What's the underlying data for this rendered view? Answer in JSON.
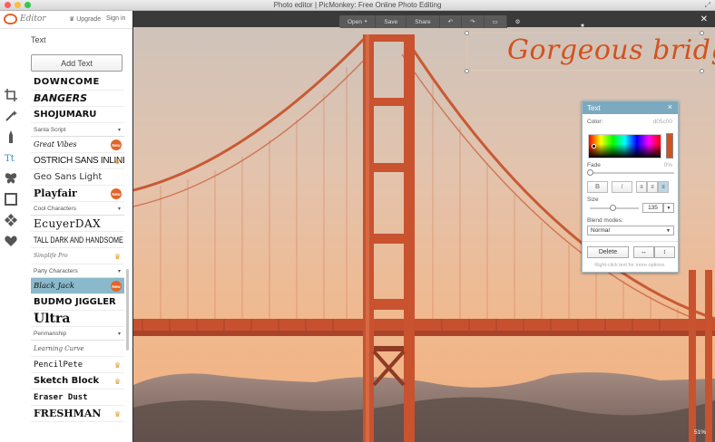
{
  "window": {
    "title": "Photo editor | PicMonkey: Free Online Photo Editing"
  },
  "header": {
    "logo_text": "Editor",
    "upgrade": "Upgrade",
    "signin": "Sign in"
  },
  "panel": {
    "title": "Text",
    "add_text": "Add Text",
    "fonts": [
      {
        "kind": "font",
        "label": "DOWNCOME"
      },
      {
        "kind": "font",
        "label": "BANGERS"
      },
      {
        "kind": "font",
        "label": "SHOJUMARU"
      },
      {
        "kind": "cat",
        "label": "Santa Script"
      },
      {
        "kind": "font",
        "label": "Great Vibes",
        "badge": "New"
      },
      {
        "kind": "font",
        "label": "OSTRICH SANS INLINE",
        "crown": true
      },
      {
        "kind": "font",
        "label": "Geo Sans Light"
      },
      {
        "kind": "font",
        "label": "Playfair",
        "badge": "New"
      },
      {
        "kind": "cat",
        "label": "Cool Characters"
      },
      {
        "kind": "font",
        "label": "EcuyerDAX"
      },
      {
        "kind": "font",
        "label": "TALL DARK AND HANDSOME"
      },
      {
        "kind": "font",
        "label": "Simplife Pro",
        "crown": true
      },
      {
        "kind": "cat",
        "label": "Party Characters"
      },
      {
        "kind": "font",
        "label": "Black Jack",
        "badge": "New",
        "selected": true
      },
      {
        "kind": "font",
        "label": "BUDMO JIGGLER"
      },
      {
        "kind": "font",
        "label": "Ultra"
      },
      {
        "kind": "cat",
        "label": "Penmanship"
      },
      {
        "kind": "font",
        "label": "Learning Curve"
      },
      {
        "kind": "font",
        "label": "PencilPete",
        "crown": true
      },
      {
        "kind": "font",
        "label": "Sketch Block",
        "crown": true
      },
      {
        "kind": "font",
        "label": "Eraser Dust"
      },
      {
        "kind": "font",
        "label": "FRESHMAN",
        "crown": true
      }
    ]
  },
  "photo_toolbar": {
    "open": "Open",
    "save": "Save",
    "share": "Share"
  },
  "canvas": {
    "overlay_text": "Gorgeous bridge!",
    "zoom": "51%"
  },
  "text_palette": {
    "title": "Text",
    "color_label": "Color:",
    "color_hex": "d05c00",
    "fade_label": "Fade",
    "fade_value": "0%",
    "fade_fraction": 0,
    "bold": "B",
    "italic": "I",
    "size_label": "Size",
    "size_value": "135",
    "blend_label": "Blend modes:",
    "blend_value": "Normal",
    "delete": "Delete",
    "hint": "Right-click text for more options."
  },
  "colors": {
    "accent": "#e1652a",
    "text_color": "#d2521e",
    "palette_header": "#7ba9bf",
    "selected_row": "#8ab9cc"
  }
}
